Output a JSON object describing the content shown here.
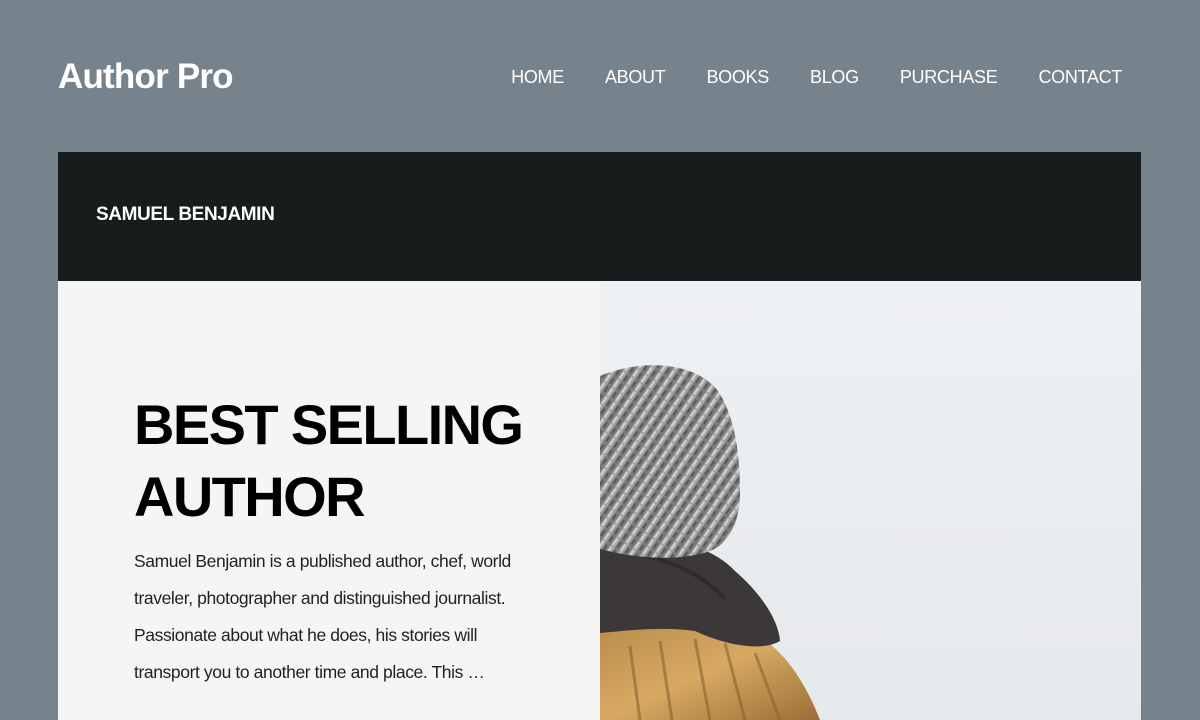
{
  "site": {
    "title": "Author Pro"
  },
  "nav": {
    "items": [
      {
        "label": "HOME"
      },
      {
        "label": "ABOUT"
      },
      {
        "label": "BOOKS"
      },
      {
        "label": "BLOG"
      },
      {
        "label": "PURCHASE"
      },
      {
        "label": "CONTACT"
      }
    ]
  },
  "author_bar": {
    "name": "SAMUEL BENJAMIN"
  },
  "hero": {
    "heading": "BEST SELLING AUTHOR",
    "body": "Samuel Benjamin is a published author, chef, world traveler, photographer and distinguished journalist. Passionate about what he does, his stories will transport you to another time and place. This …",
    "image_icon": "person-in-knit-hat-photo"
  },
  "colors": {
    "page_background": "#77838c",
    "author_bar_background": "#171c1c",
    "hero_text_background": "#f5f5f5",
    "text_light": "#ffffff",
    "text_dark": "#000000"
  }
}
